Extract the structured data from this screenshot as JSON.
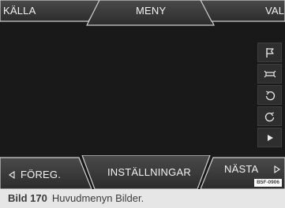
{
  "top_bar": {
    "source_label": "KÄLLA",
    "menu_label": "MENY",
    "select_label": "VAL"
  },
  "bottom_bar": {
    "previous_label": "FÖREG.",
    "settings_label": "INSTÄLLNINGAR",
    "next_label": "NÄSTA"
  },
  "side_buttons": [
    {
      "icon": "flag-icon"
    },
    {
      "icon": "fit-to-screen-icon"
    },
    {
      "icon": "rotate-left-icon"
    },
    {
      "icon": "rotate-right-icon"
    },
    {
      "icon": "play-icon"
    }
  ],
  "image_code": "B5F-0906",
  "caption": {
    "figure_label": "Bild 170",
    "text": "Huvudmenyn Bilder."
  },
  "colors": {
    "screen_background": "#191919",
    "button_fill": "#363636",
    "text": "#f2f2f2"
  }
}
